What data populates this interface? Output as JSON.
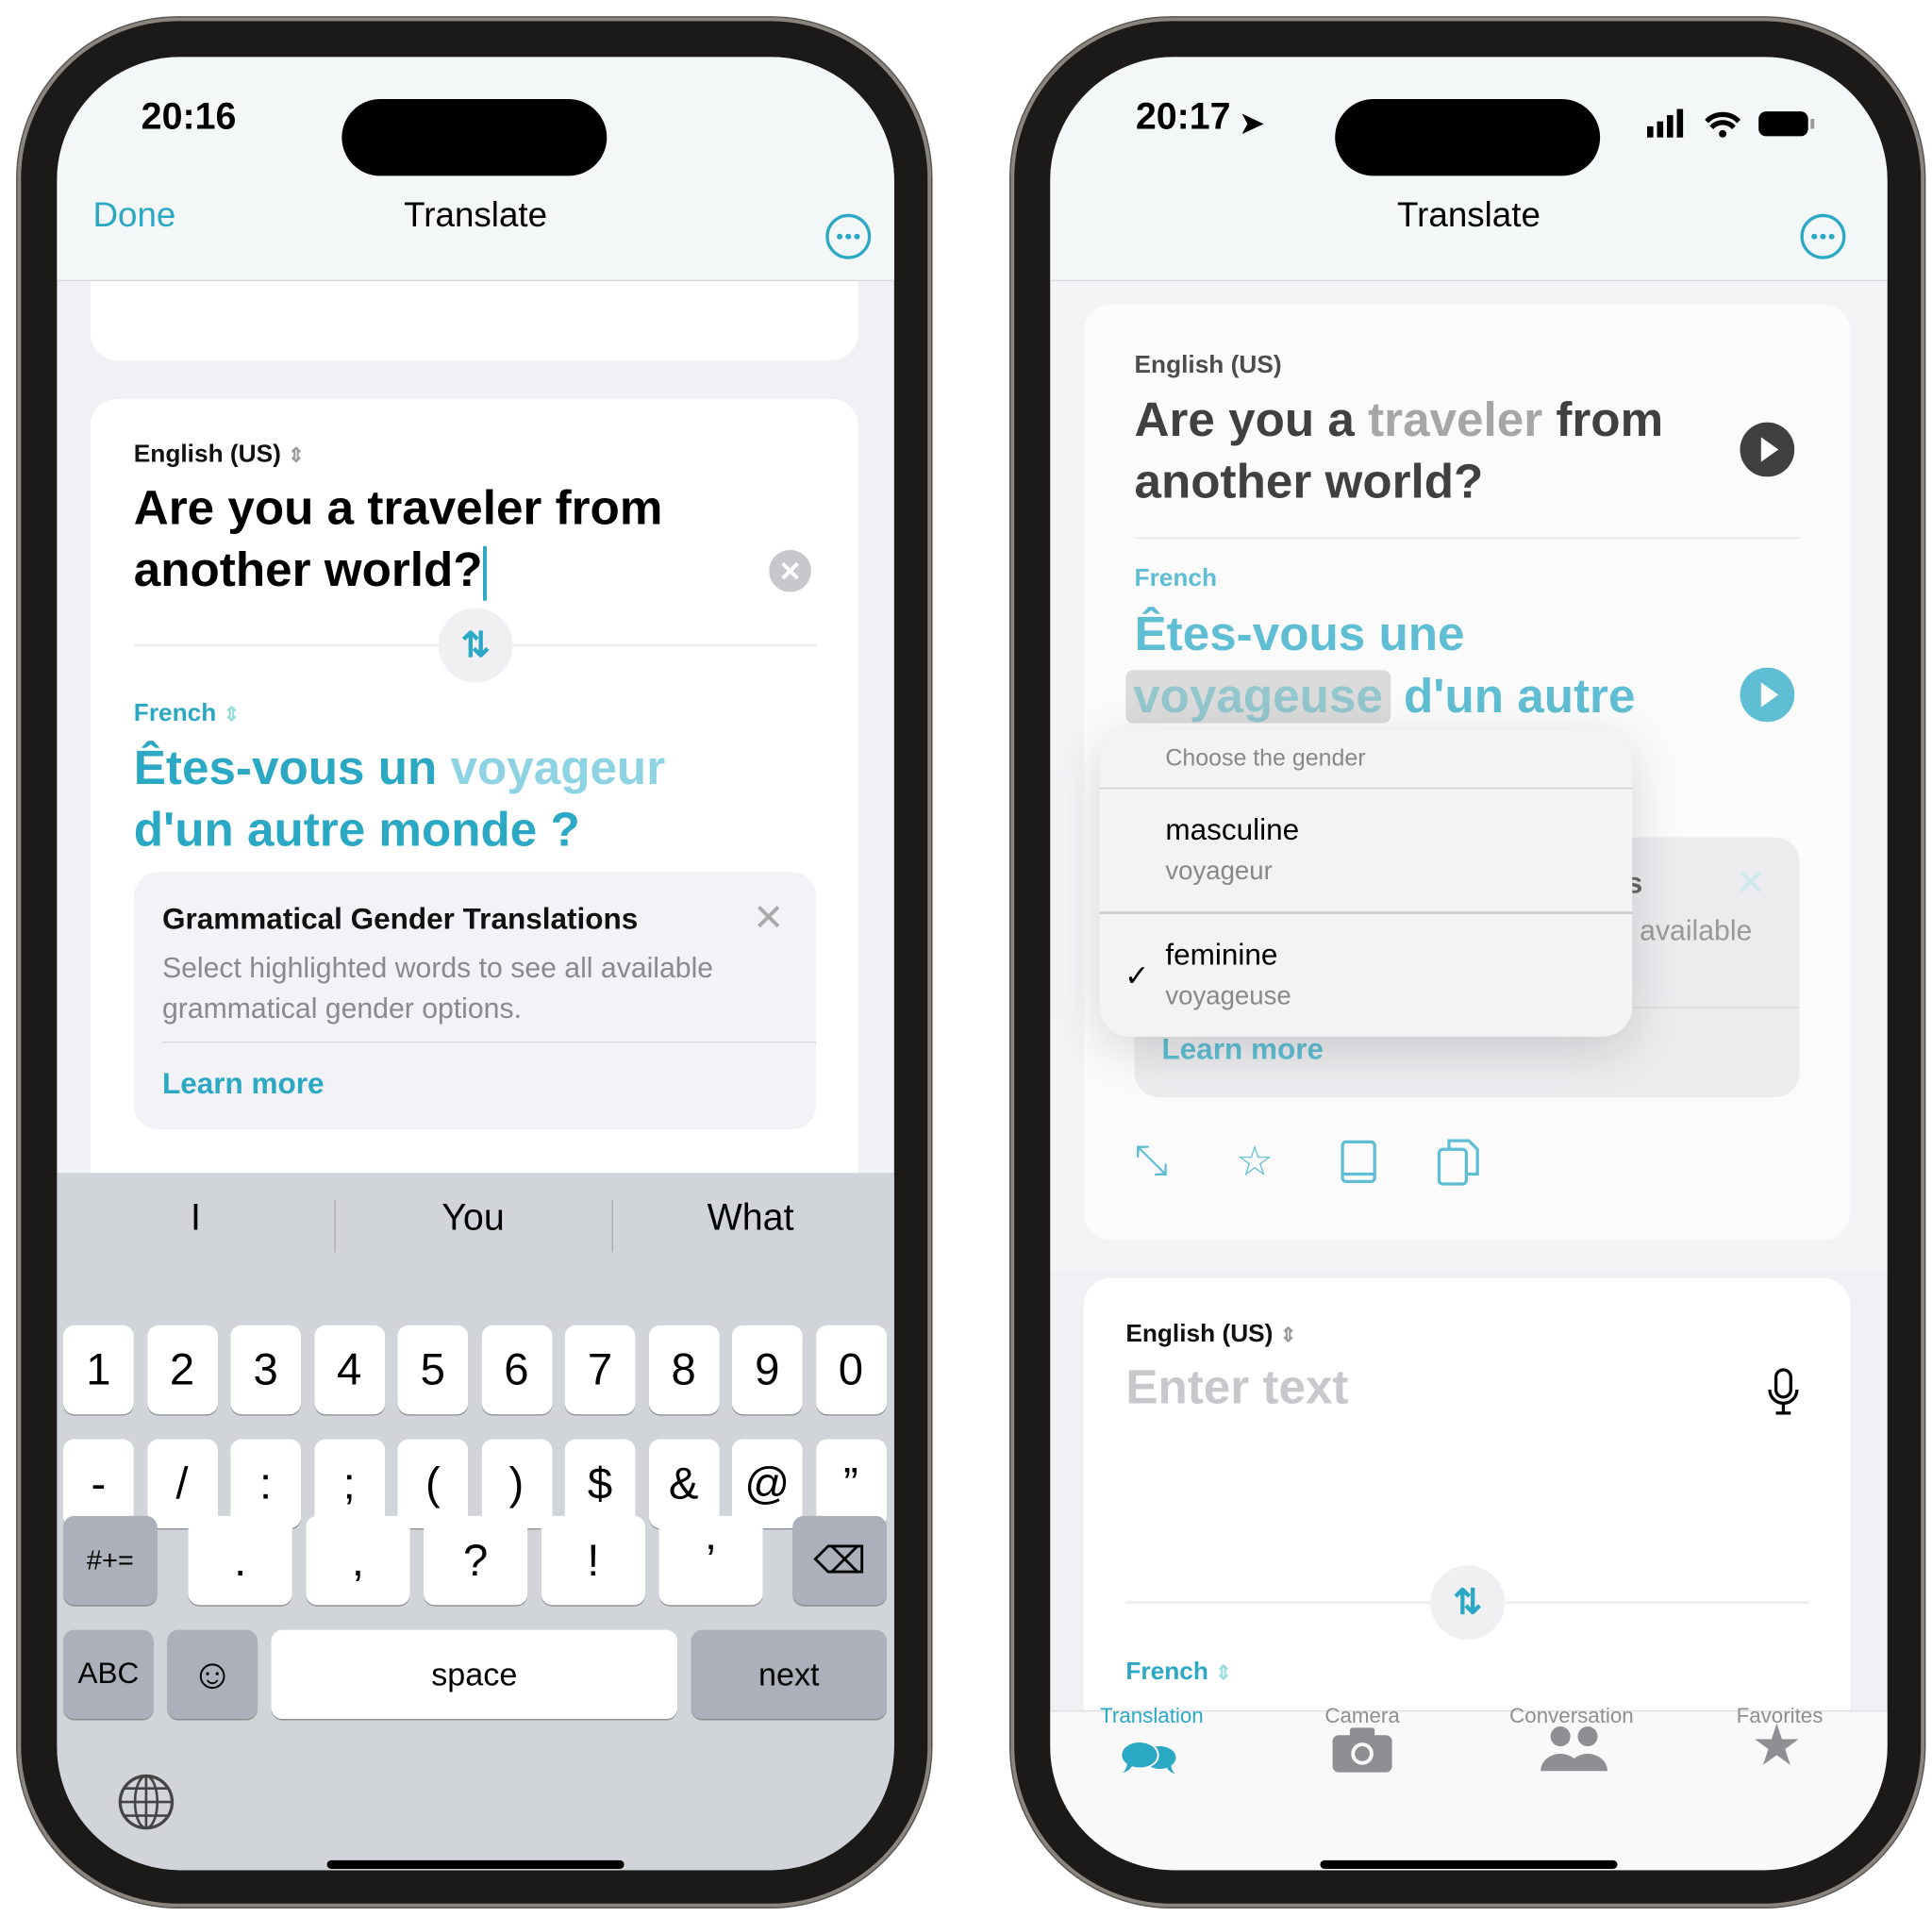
{
  "left": {
    "status": {
      "time": "20:16"
    },
    "nav": {
      "done": "Done",
      "title": "Translate"
    },
    "source": {
      "lang": "English (US)",
      "text_line1": "Are you a traveler from",
      "text_line2": "another world?"
    },
    "target": {
      "lang": "French",
      "line1_a": "Êtes-vous un ",
      "line1_b": "voyageur",
      "line2": "d'un autre monde ?"
    },
    "info": {
      "title": "Grammatical Gender Translations",
      "body1": "Select highlighted words to see all available",
      "body2": "grammatical gender options.",
      "link": "Learn more"
    },
    "keyboard": {
      "suggestions": [
        "I",
        "You",
        "What"
      ],
      "row1": [
        "1",
        "2",
        "3",
        "4",
        "5",
        "6",
        "7",
        "8",
        "9",
        "0"
      ],
      "row2": [
        "-",
        "/",
        ":",
        ";",
        "(",
        ")",
        "$",
        "&",
        "@",
        "”"
      ],
      "row3": [
        ".",
        ",",
        "?",
        "!",
        "’"
      ],
      "symbols": "#+=",
      "abc": "ABC",
      "space": "space",
      "next": "next"
    }
  },
  "right": {
    "status": {
      "time": "20:17"
    },
    "nav": {
      "title": "Translate"
    },
    "source": {
      "lang": "English (US)",
      "l1a": "Are you a ",
      "l1b": "traveler",
      "l1c": " from",
      "l2": "another world?"
    },
    "target": {
      "lang": "French",
      "line1": "Êtes-vous une",
      "word": "voyageuse",
      "line2_rest": "d'un autre"
    },
    "info_partial": {
      "s": "s",
      "available": "available",
      "link": "Learn more"
    },
    "menu": {
      "header": "Choose the gender",
      "options": [
        {
          "label": "masculine",
          "word": "voyageur",
          "checked": false
        },
        {
          "label": "feminine",
          "word": "voyageuse",
          "checked": true
        }
      ]
    },
    "input": {
      "lang": "English (US)",
      "placeholder": "Enter text",
      "target_lang": "French"
    },
    "tabs": [
      {
        "label": "Translation",
        "active": true
      },
      {
        "label": "Camera"
      },
      {
        "label": "Conversation"
      },
      {
        "label": "Favorites"
      }
    ]
  },
  "colors": {
    "accent": "#2aa8c4",
    "keyboard": "#d1d4d9"
  }
}
